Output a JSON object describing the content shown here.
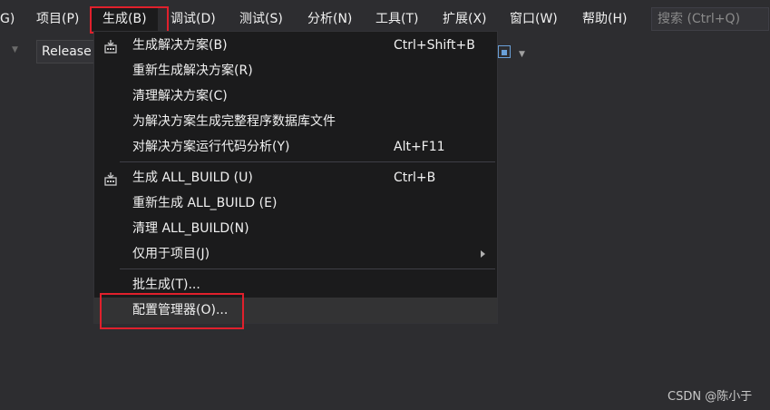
{
  "menubar": {
    "items": [
      {
        "label": "G)"
      },
      {
        "label": "项目(P)"
      },
      {
        "label": "生成(B)"
      },
      {
        "label": "调试(D)"
      },
      {
        "label": "测试(S)"
      },
      {
        "label": "分析(N)"
      },
      {
        "label": "工具(T)"
      },
      {
        "label": "扩展(X)"
      },
      {
        "label": "窗口(W)"
      },
      {
        "label": "帮助(H)"
      }
    ],
    "search_placeholder": "搜索 (Ctrl+Q)"
  },
  "toolbar": {
    "configuration": "Release"
  },
  "build_menu": {
    "items": [
      {
        "label": "生成解决方案(B)",
        "shortcut": "Ctrl+Shift+B",
        "icon": "build-icon"
      },
      {
        "label": "重新生成解决方案(R)",
        "shortcut": ""
      },
      {
        "label": "清理解决方案(C)",
        "shortcut": ""
      },
      {
        "label": "为解决方案生成完整程序数据库文件",
        "shortcut": ""
      },
      {
        "label": "对解决方案运行代码分析(Y)",
        "shortcut": "Alt+F11"
      },
      {
        "label": "生成 ALL_BUILD (U)",
        "shortcut": "Ctrl+B",
        "icon": "build-icon"
      },
      {
        "label": "重新生成 ALL_BUILD (E)",
        "shortcut": ""
      },
      {
        "label": "清理 ALL_BUILD(N)",
        "shortcut": ""
      },
      {
        "label": "仅用于项目(J)",
        "shortcut": "",
        "submenu": true
      },
      {
        "label": "批生成(T)...",
        "shortcut": ""
      },
      {
        "label": "配置管理器(O)...",
        "shortcut": "",
        "highlighted": true
      }
    ]
  },
  "watermark": "CSDN @陈小于",
  "colors": {
    "background": "#2d2d30",
    "menu_background": "#1b1b1c",
    "highlight_box": "#e0202c",
    "hover": "#333334"
  }
}
